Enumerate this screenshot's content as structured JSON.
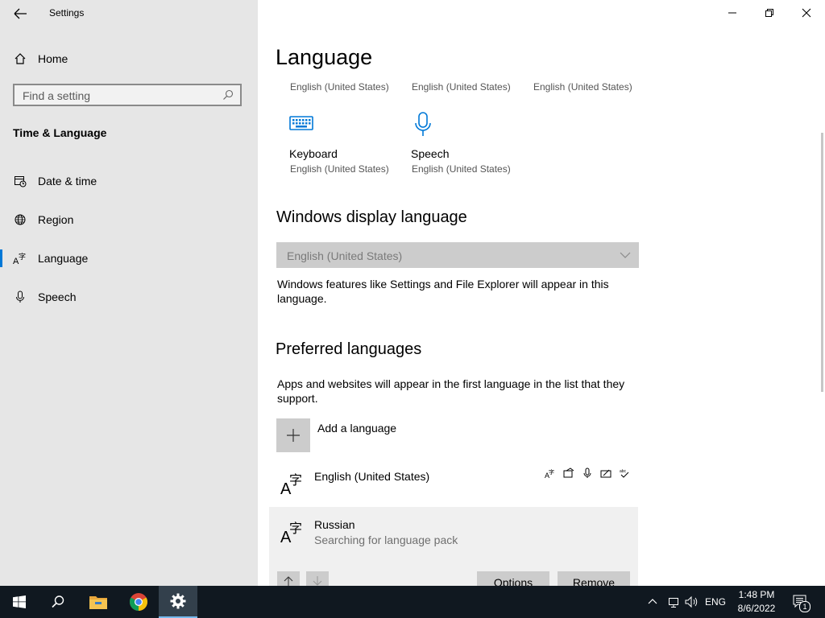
{
  "window": {
    "title": "Settings"
  },
  "sidebar": {
    "home_label": "Home",
    "search_placeholder": "Find a setting",
    "section_title": "Time & Language",
    "items": [
      {
        "label": "Date & time",
        "icon": "calendar-clock-icon"
      },
      {
        "label": "Region",
        "icon": "globe-icon"
      },
      {
        "label": "Language",
        "icon": "language-icon",
        "selected": true
      },
      {
        "label": "Speech",
        "icon": "microphone-icon"
      }
    ]
  },
  "main": {
    "title": "Language",
    "top_captions": [
      "English (United States)",
      "English (United States)",
      "English (United States)"
    ],
    "tiles": [
      {
        "label": "Keyboard",
        "sub": "English (United States)",
        "icon": "keyboard-icon"
      },
      {
        "label": "Speech",
        "sub": "English (United States)",
        "icon": "microphone-icon"
      }
    ],
    "display_language": {
      "heading": "Windows display language",
      "selected_value": "English (United States)",
      "description": "Windows features like Settings and File Explorer will appear in this language."
    },
    "preferred": {
      "heading": "Preferred languages",
      "description": "Apps and websites will appear in the first language in the list that they support.",
      "add_label": "Add a language",
      "languages": [
        {
          "name": "English (United States)",
          "status": ""
        },
        {
          "name": "Russian",
          "status": "Searching for language pack"
        }
      ],
      "options_label": "Options",
      "remove_label": "Remove"
    }
  },
  "taskbar": {
    "apps": [
      "start-icon",
      "search-icon",
      "file-explorer-icon",
      "chrome-icon",
      "settings-icon"
    ],
    "input_language": "ENG",
    "time": "1:48 PM",
    "date": "8/6/2022",
    "notification_count": "1"
  },
  "colors": {
    "accent": "#0078d7",
    "sidebar_bg": "#e6e6e6",
    "taskbar_bg": "#101820"
  }
}
